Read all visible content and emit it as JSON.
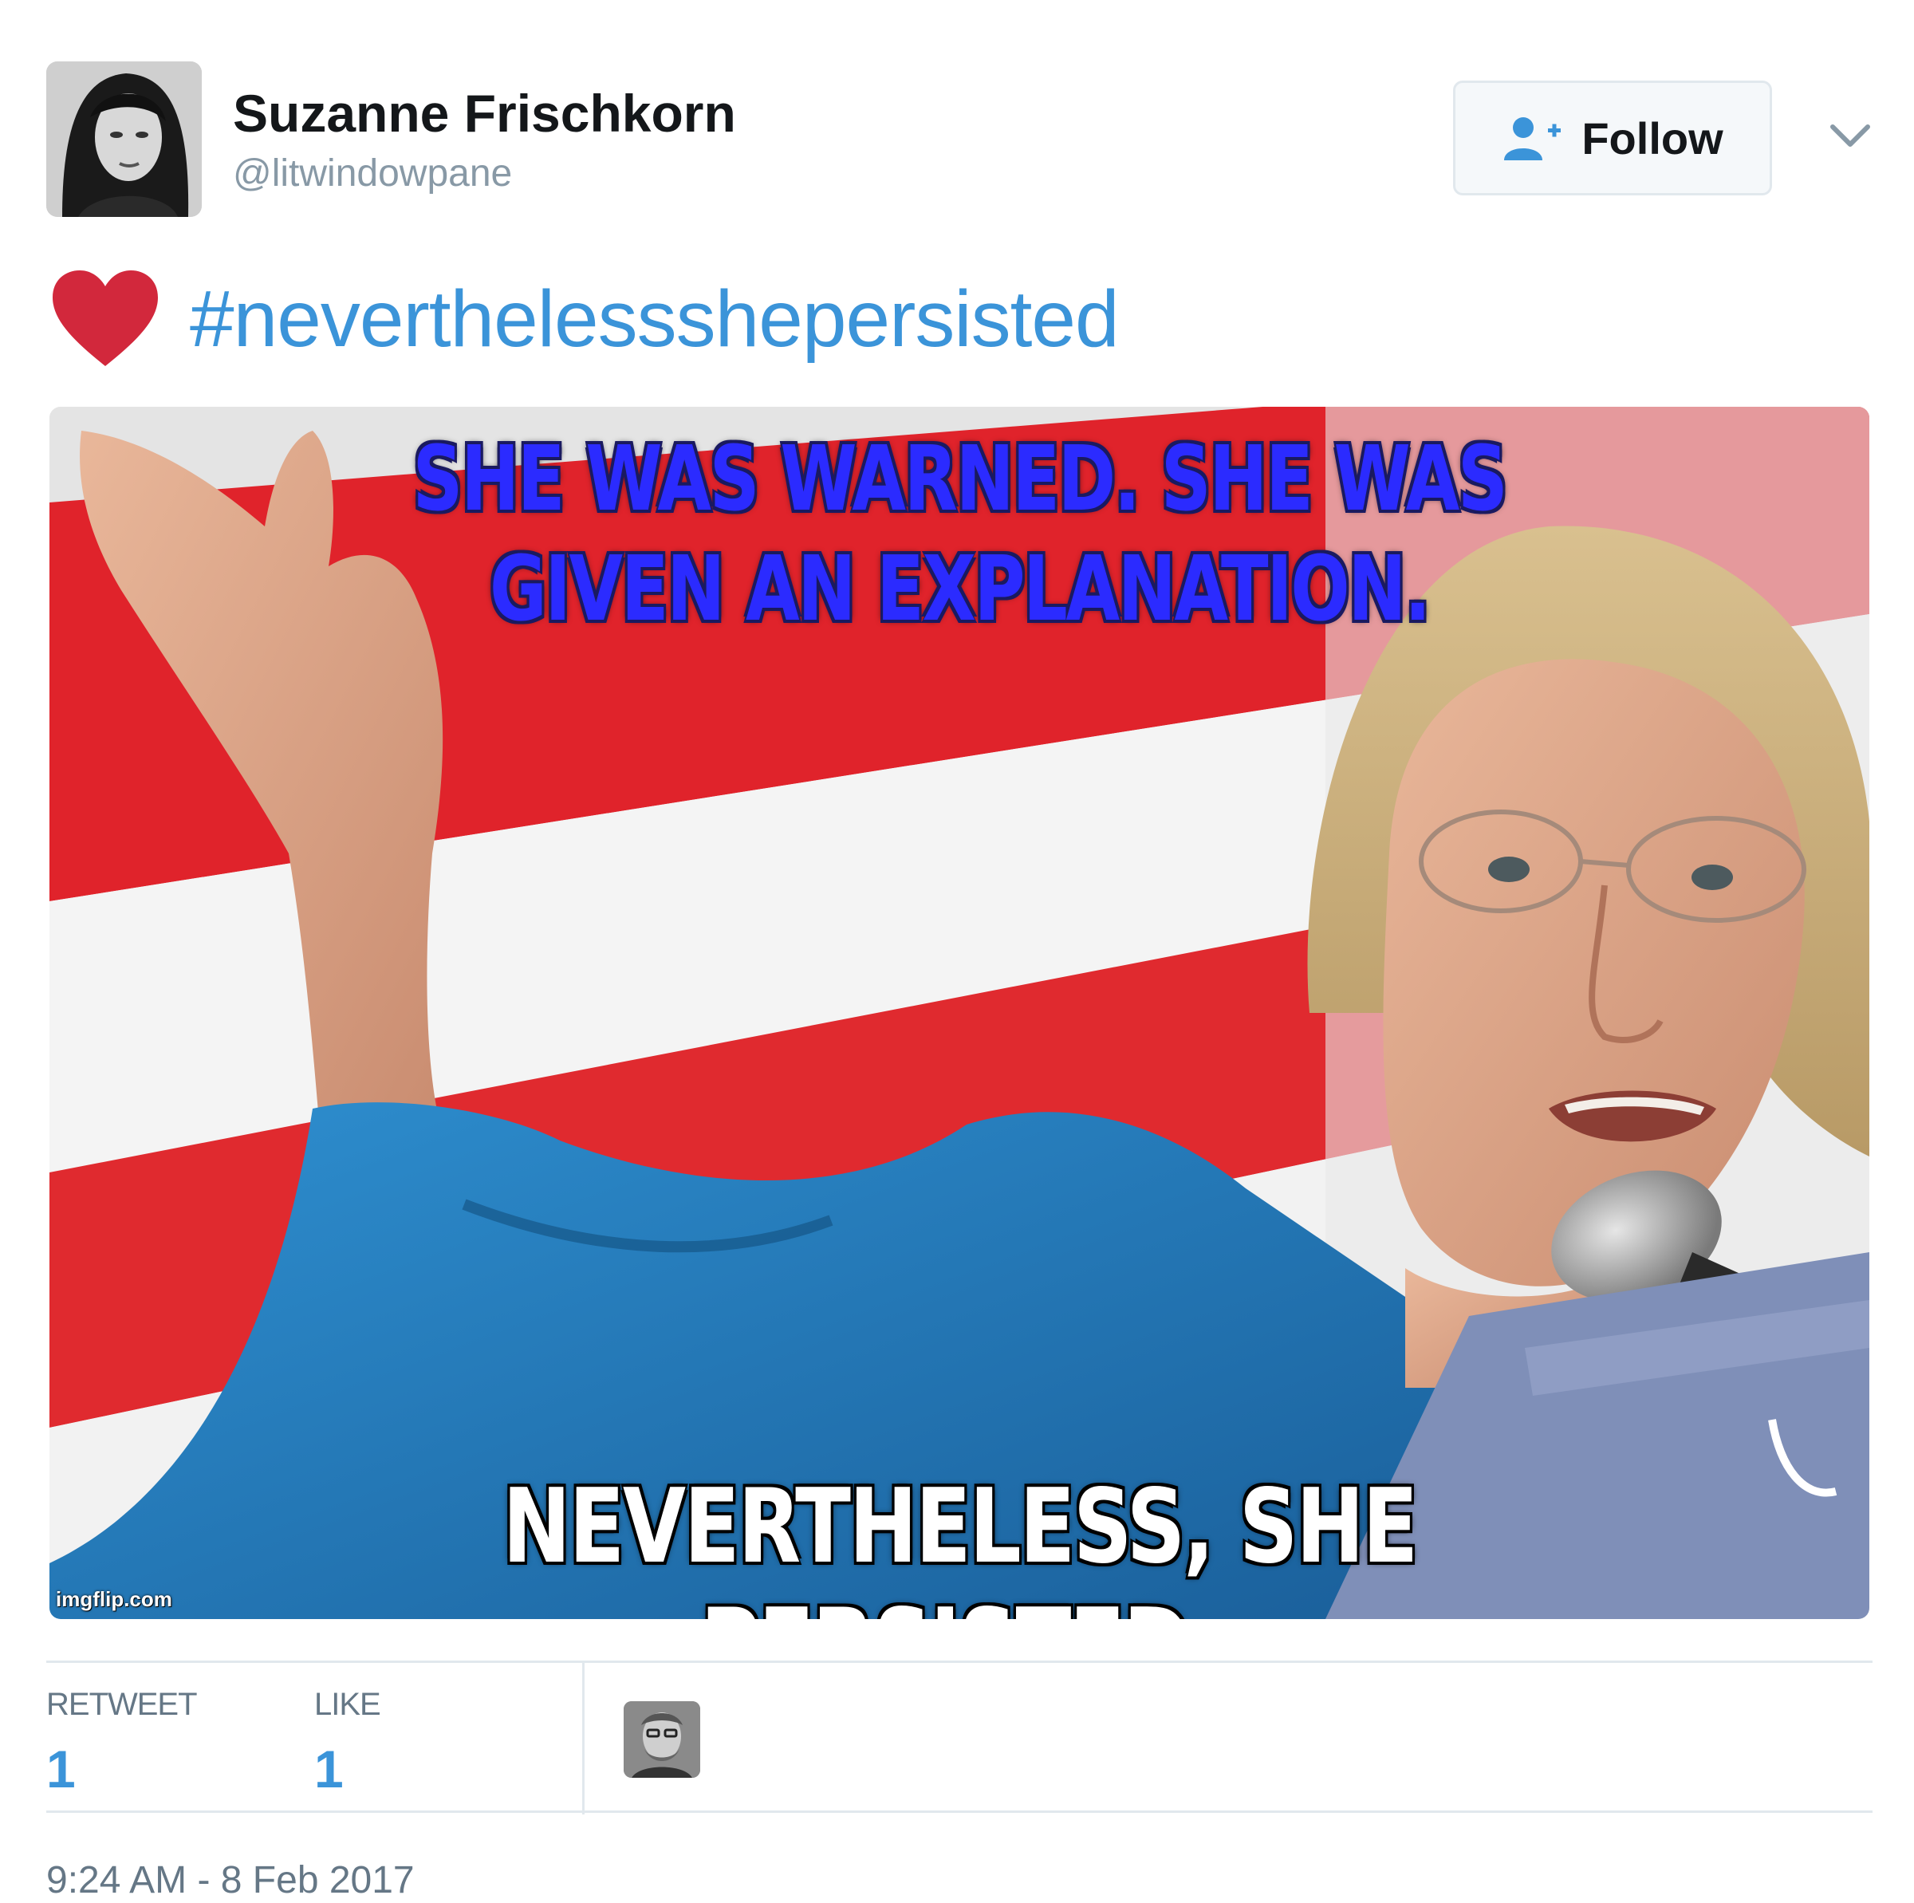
{
  "user": {
    "name": "Suzanne Frischkorn",
    "handle": "@litwindowpane"
  },
  "follow_button": {
    "label": "Follow"
  },
  "tweet": {
    "emoji": "heart",
    "hashtag": "#neverthelessshepersisted"
  },
  "media": {
    "caption_top_line1": "SHE WAS WARNED. SHE WAS",
    "caption_top_line2": "GIVEN AN EXPLANATION.",
    "caption_bottom": "NEVERTHELESS, SHE PERSISTED.",
    "watermark": "imgflip.com"
  },
  "stats": {
    "retweet_label": "RETWEET",
    "retweet_count": "1",
    "like_label": "LIKE",
    "like_count": "1"
  },
  "timestamp": "9:24 AM - 8 Feb 2017",
  "colors": {
    "link_blue": "#3b94d9",
    "heart_red": "#d2283c",
    "meme_top_text": "#2b2bff",
    "meme_bottom_text": "#ffffff"
  },
  "icons": [
    "follow-user-icon",
    "chevron-down-icon",
    "heart-emoji-icon"
  ]
}
